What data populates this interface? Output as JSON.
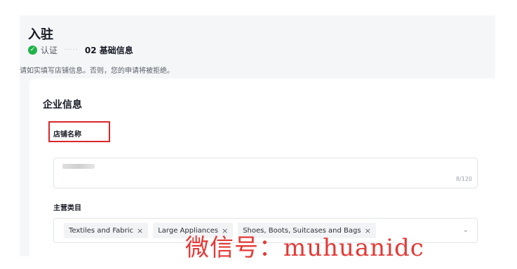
{
  "header": {
    "title": "入驻",
    "steps": [
      {
        "label": "认证",
        "status": "done"
      },
      {
        "label": "02 基础信息",
        "status": "current"
      }
    ],
    "dots": "·····",
    "notice": "请如实填写店铺信息。否则，您的申请将被拒绝。"
  },
  "section": {
    "title": "企业信息",
    "store_name": {
      "label": "店铺名称",
      "counter": "8/120"
    },
    "category": {
      "label": "主营类目",
      "tags": [
        "Textiles and Fabric",
        "Large Appliances",
        "Shoes, Boots, Suitcases and Bags"
      ],
      "remove_glyph": "×",
      "chevron_glyph": "⌄"
    }
  },
  "watermark": "微信号：muhuanidc",
  "colors": {
    "success": "#20b24a",
    "highlight": "#d9262b",
    "watermark": "#e53935"
  },
  "icons": {
    "step_done": "check-icon",
    "select": "chevron-down-icon",
    "tag_remove": "close-icon"
  }
}
